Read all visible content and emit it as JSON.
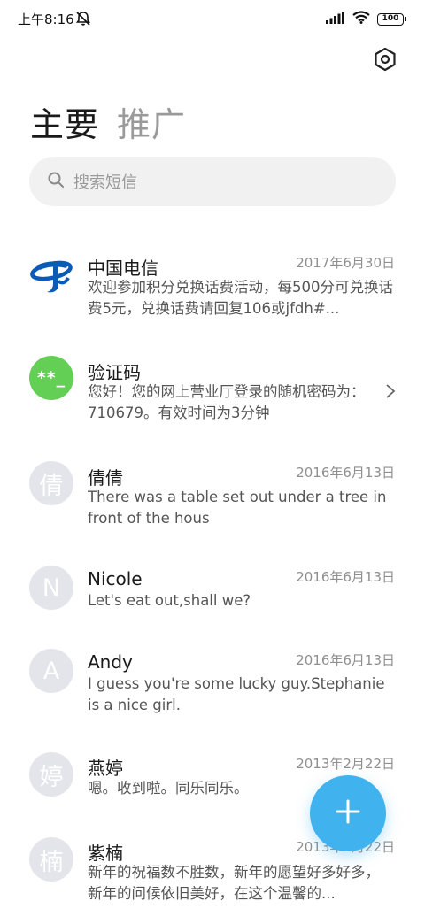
{
  "status_bar": {
    "time": "上午8:16",
    "battery": "100",
    "icons": [
      "dnd-muted-icon",
      "signal-icon",
      "wifi-icon",
      "battery-icon"
    ]
  },
  "header": {
    "settings_icon": "hexagon-settings-icon",
    "tabs": [
      {
        "label": "主要",
        "active": true
      },
      {
        "label": "推广",
        "active": false
      }
    ]
  },
  "search": {
    "placeholder": "搜索短信",
    "icon": "search-icon"
  },
  "conversations": [
    {
      "name": "中国电信",
      "date": "2017年6月30日",
      "preview": "欢迎参加积分兑换话费活动，每500分可兑换话费5元，兑换话费请回复106或jfdh#...",
      "avatar": "china-telecom-logo"
    },
    {
      "name": "验证码",
      "date": "",
      "preview": "您好！您的网上营业厅登录的随机密码为：710679。有效时间为3分钟",
      "avatar_text": "**_",
      "avatar_color": "#63cf55"
    },
    {
      "name": "倩倩",
      "date": "2016年6月13日",
      "preview": "There was a table set out under a tree in front of the hous",
      "avatar_text": "倩"
    },
    {
      "name": "Nicole",
      "date": "2016年6月13日",
      "preview": "Let's eat out,shall we?",
      "avatar_text": "N"
    },
    {
      "name": "Andy",
      "date": "2016年6月13日",
      "preview": "I guess you're some lucky guy.Stephanie is a nice girl.",
      "avatar_text": "A"
    },
    {
      "name": "燕婷",
      "date": "2013年2月22日",
      "preview": "嗯。收到啦。同乐同乐。",
      "avatar_text": "婷"
    },
    {
      "name": "紫楠",
      "date": "2013年2月22日",
      "preview": "新年的祝福数不胜数，新年的愿望好多好多，新年的问候依旧美好，在这个温馨的...",
      "avatar_text": "楠"
    }
  ],
  "fab": {
    "icon": "plus-icon",
    "color": "#40b3ee"
  },
  "colors": {
    "accent": "#40b3ee",
    "avatar_grey": "#e3e5ea",
    "verification_green": "#63cf55",
    "telecom_blue": "#0a5bb6"
  }
}
